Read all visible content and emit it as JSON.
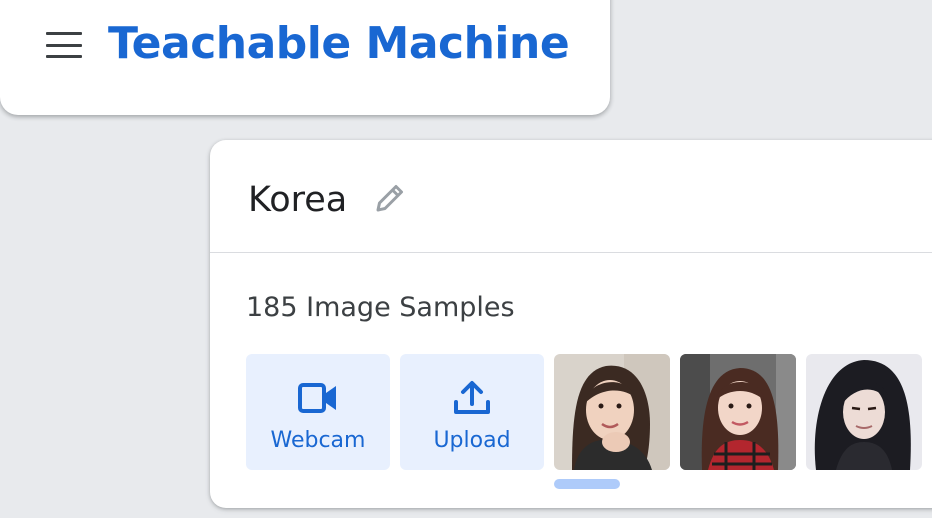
{
  "header": {
    "title": "Teachable Machine",
    "menu_icon": "hamburger-menu-icon"
  },
  "class_card": {
    "name": "Korea",
    "edit_icon": "pencil-icon",
    "samples_label": "185 Image Samples",
    "webcam_label": "Webcam",
    "webcam_icon": "videocam-icon",
    "upload_label": "Upload",
    "upload_icon": "upload-icon",
    "thumbnails": [
      {
        "name": "sample-image-1"
      },
      {
        "name": "sample-image-2"
      },
      {
        "name": "sample-image-3"
      }
    ]
  },
  "colors": {
    "brand": "#1967d2",
    "tile_bg": "#e8f0fe",
    "page_bg": "#e8eaed",
    "scroll_indicator": "#aecbfa"
  }
}
